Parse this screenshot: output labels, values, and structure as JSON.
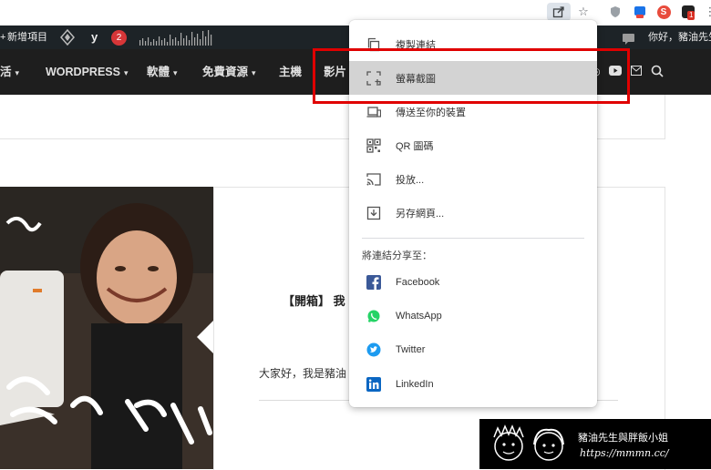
{
  "browser": {
    "icons": [
      "share-icon",
      "star-icon",
      "shield-extension-icon",
      "translate-extension-icon",
      "s-extension-icon",
      "notification-extension-icon",
      "puzzle-icon"
    ],
    "notification_badge": "1"
  },
  "admin_bar": {
    "new_item": "新增項目",
    "yoast_badge": "2",
    "greeting": "你好，豬油先生"
  },
  "site_nav": {
    "items": [
      "活",
      "WORDPRESS",
      "軟體",
      "免費資源",
      "主機",
      "影片"
    ]
  },
  "post": {
    "title": "【開箱】 我",
    "excerpt": "大家好，我是豬油"
  },
  "share_menu": {
    "items": [
      {
        "label": "複製連結",
        "icon": "copy-icon"
      },
      {
        "label": "螢幕截圖",
        "icon": "screenshot-icon",
        "highlighted": true
      },
      {
        "label": "傳送至你的裝置",
        "icon": "devices-icon"
      },
      {
        "label": "QR 圖碼",
        "icon": "qr-code-icon"
      },
      {
        "label": "投放...",
        "icon": "cast-icon"
      },
      {
        "label": "另存網頁...",
        "icon": "save-page-icon"
      }
    ],
    "section_title": "將連結分享至：",
    "targets": [
      {
        "label": "Facebook",
        "icon": "facebook-icon",
        "color": "#1877f2"
      },
      {
        "label": "WhatsApp",
        "icon": "whatsapp-icon",
        "color": "#25d366"
      },
      {
        "label": "Twitter",
        "icon": "twitter-icon",
        "color": "#1d9bf0"
      },
      {
        "label": "LinkedIn",
        "icon": "linkedin-icon",
        "color": "#0a66c2"
      }
    ]
  },
  "watermark": {
    "text": "豬油先生與胖飯小姐",
    "url": "https://mmmn.cc/"
  },
  "colors": {
    "highlight_box": "#e00000",
    "admin_bar": "#1d2327",
    "nav_bar": "#1e1e1e"
  }
}
